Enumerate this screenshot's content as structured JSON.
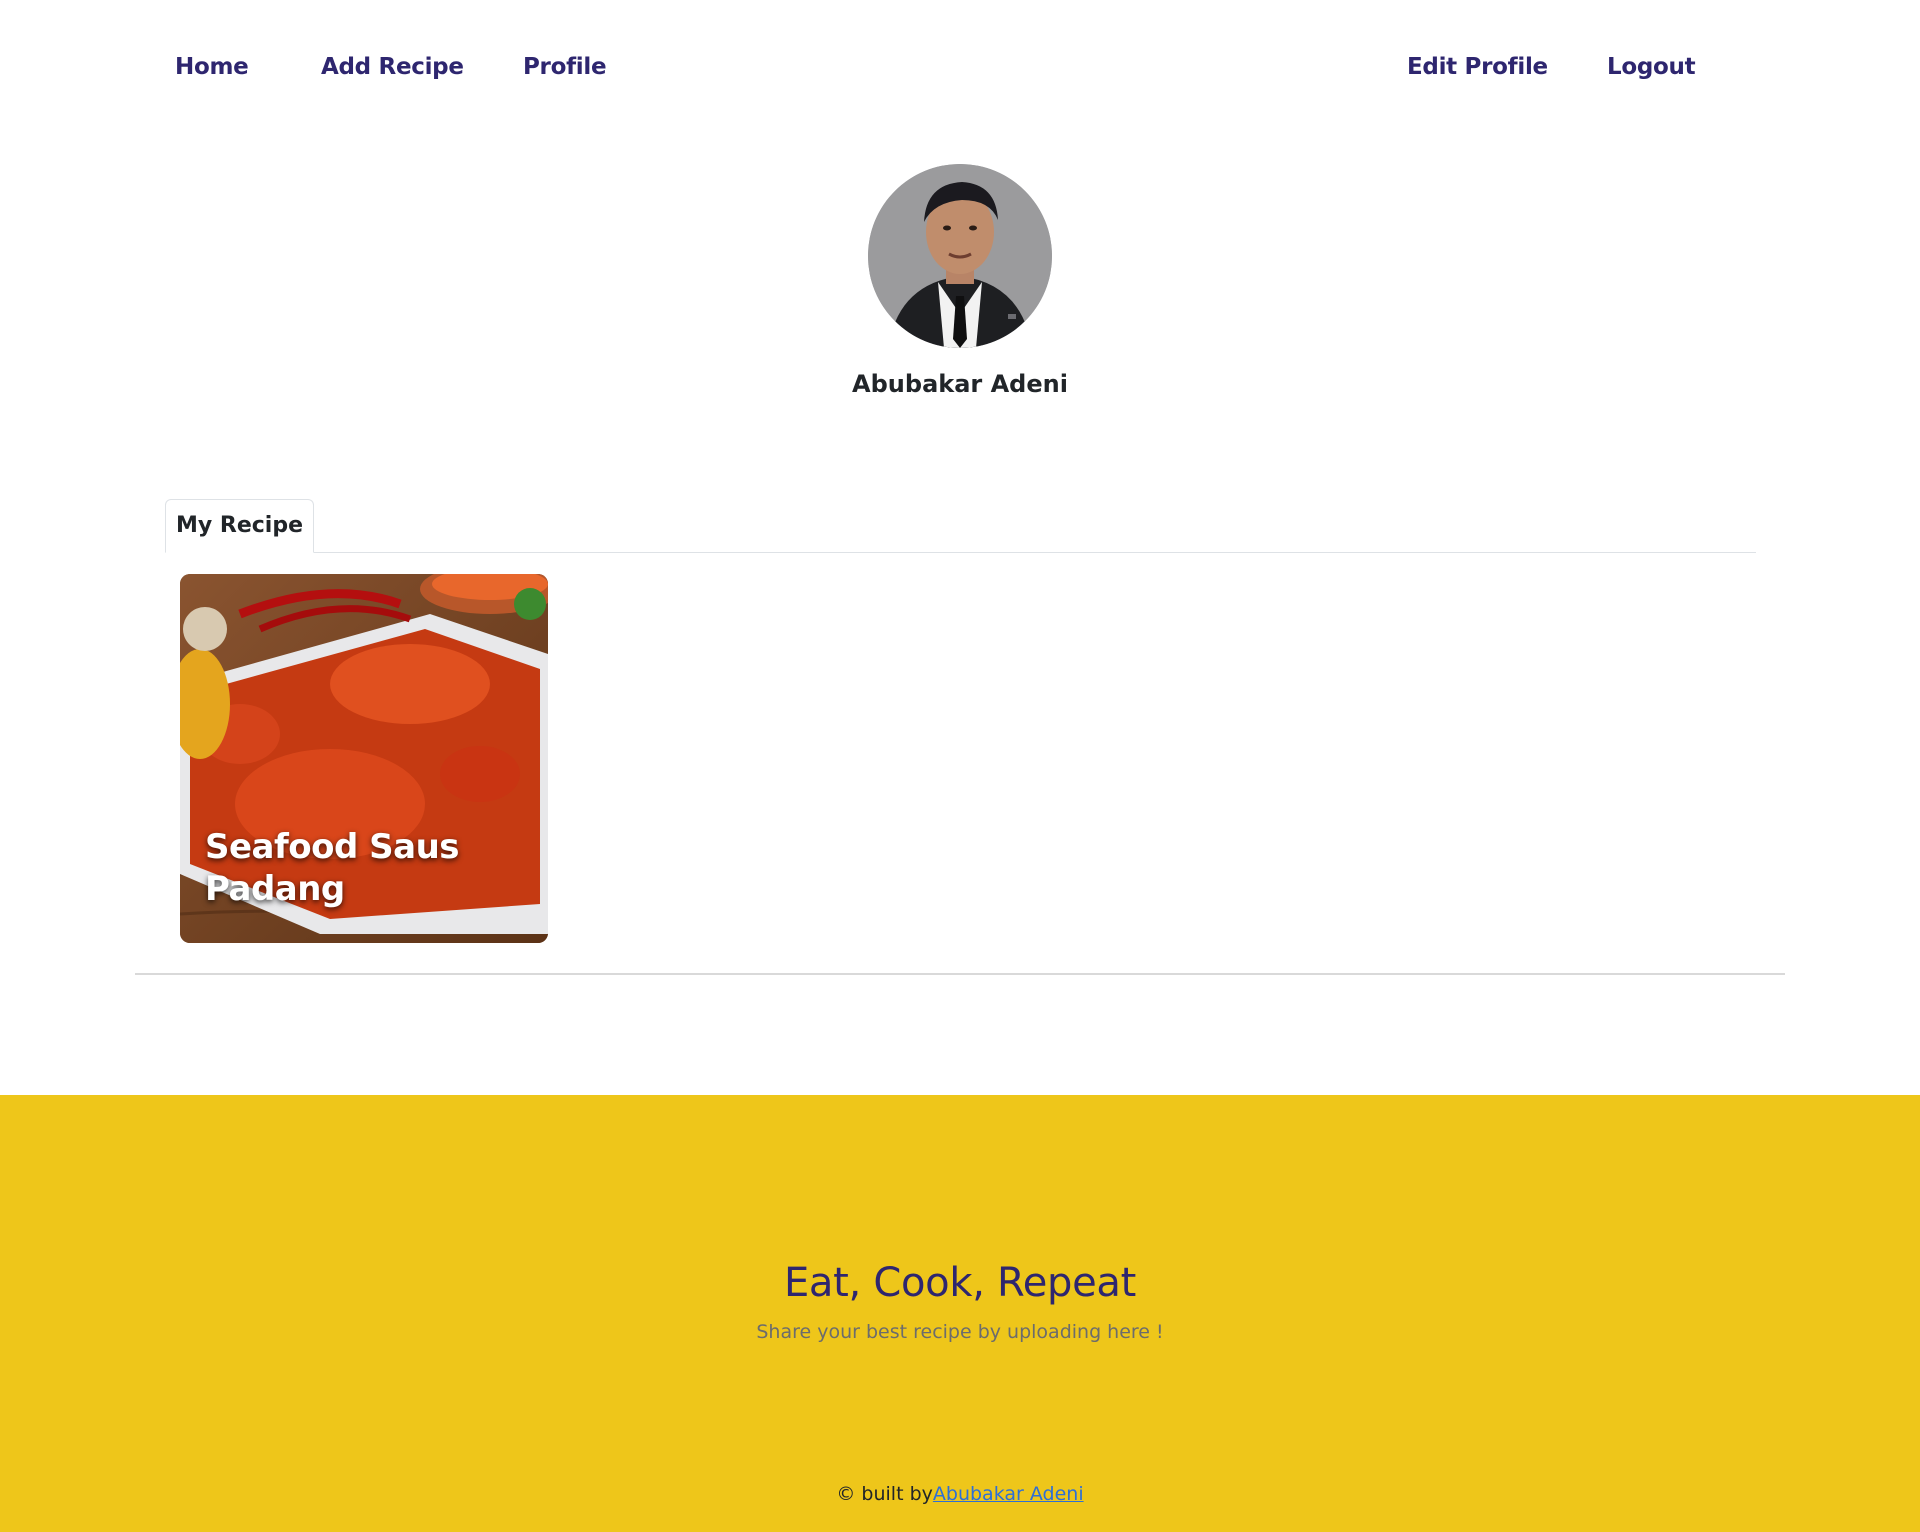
{
  "nav": {
    "home": "Home",
    "add_recipe": "Add Recipe",
    "profile": "Profile",
    "edit_profile": "Edit Profile",
    "logout": "Logout"
  },
  "profile": {
    "name": "Abubakar Adeni"
  },
  "tabs": [
    {
      "label": "My Recipe",
      "active": true
    }
  ],
  "recipes": [
    {
      "title": "Seafood Saus Padang"
    }
  ],
  "footer": {
    "title": "Eat, Cook, Repeat",
    "subtitle": "Share your best recipe by uploading here !",
    "credit_prefix": "© built by",
    "credit_link": "Abubakar Adeni"
  },
  "colors": {
    "nav_text": "#2e266f",
    "footer_bg": "#eec61a",
    "link": "#2e6fd6"
  }
}
